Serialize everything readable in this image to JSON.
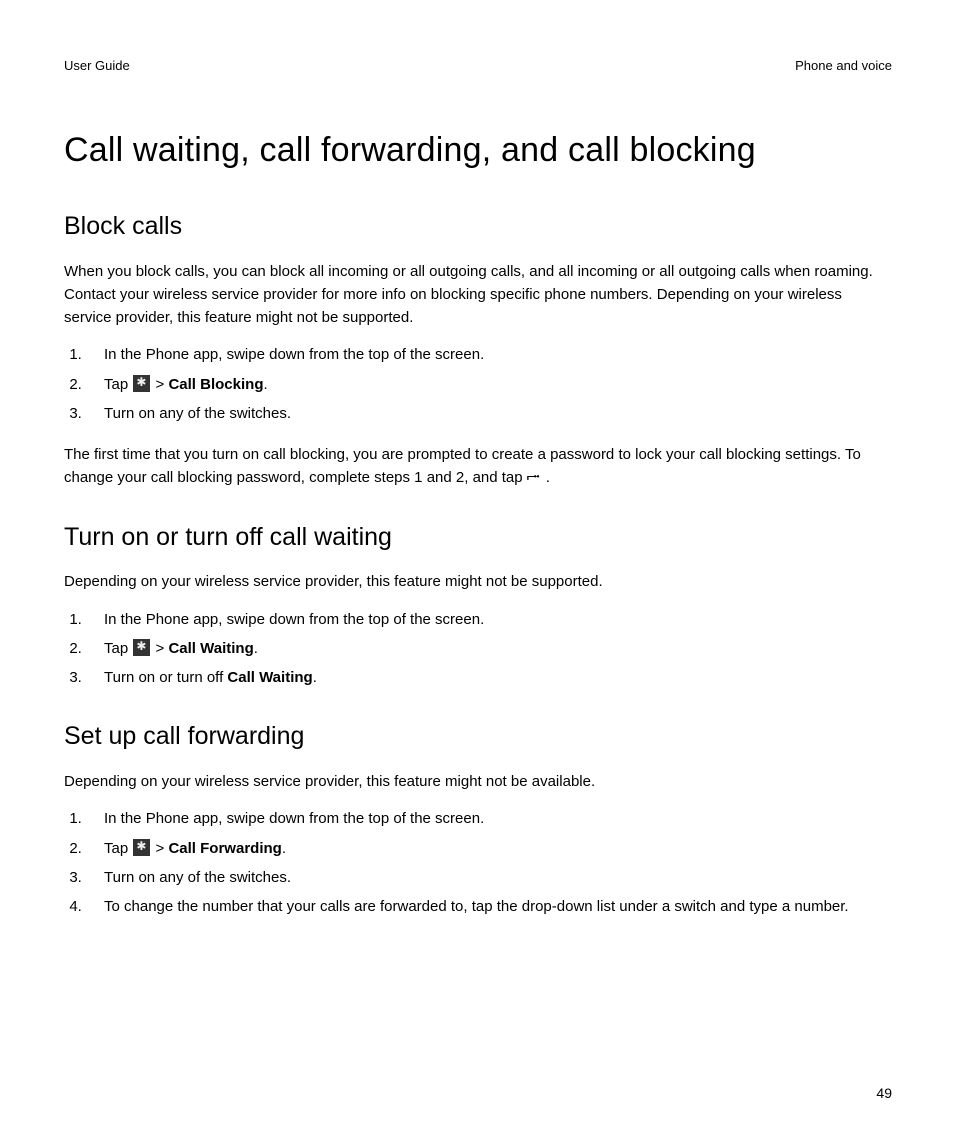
{
  "header": {
    "left": "User Guide",
    "right": "Phone and voice"
  },
  "page_number": "49",
  "title": "Call waiting, call forwarding, and call blocking",
  "s1": {
    "heading": "Block calls",
    "intro": "When you block calls, you can block all incoming or all outgoing calls, and all incoming or all outgoing calls when roaming. Contact your wireless service provider for more info on blocking specific phone numbers. Depending on your wireless service provider, this feature might not be supported.",
    "step1": "In the Phone app, swipe down from the top of the screen.",
    "step2_pre": "Tap ",
    "step2_mid": " > ",
    "step2_bold": "Call Blocking",
    "step2_end": ".",
    "step3": "Turn on any of the switches.",
    "after_a": "The first time that you turn on call blocking, you are prompted to create a password to lock your call blocking settings. To change your call blocking password, complete steps 1 and 2, and tap ",
    "after_b": "."
  },
  "s2": {
    "heading": "Turn on or turn off call waiting",
    "intro": "Depending on your wireless service provider, this feature might not be supported.",
    "step1": "In the Phone app, swipe down from the top of the screen.",
    "step2_pre": "Tap ",
    "step2_mid": " > ",
    "step2_bold": "Call Waiting",
    "step2_end": ".",
    "step3_a": "Turn on or turn off ",
    "step3_bold": "Call Waiting",
    "step3_b": "."
  },
  "s3": {
    "heading": "Set up call forwarding",
    "intro": "Depending on your wireless service provider, this feature might not be available.",
    "step1": "In the Phone app, swipe down from the top of the screen.",
    "step2_pre": "Tap ",
    "step2_mid": " > ",
    "step2_bold": "Call Forwarding",
    "step2_end": ".",
    "step3": "Turn on any of the switches.",
    "step4": "To change the number that your calls are forwarded to, tap the drop-down list under a switch and type a number."
  }
}
